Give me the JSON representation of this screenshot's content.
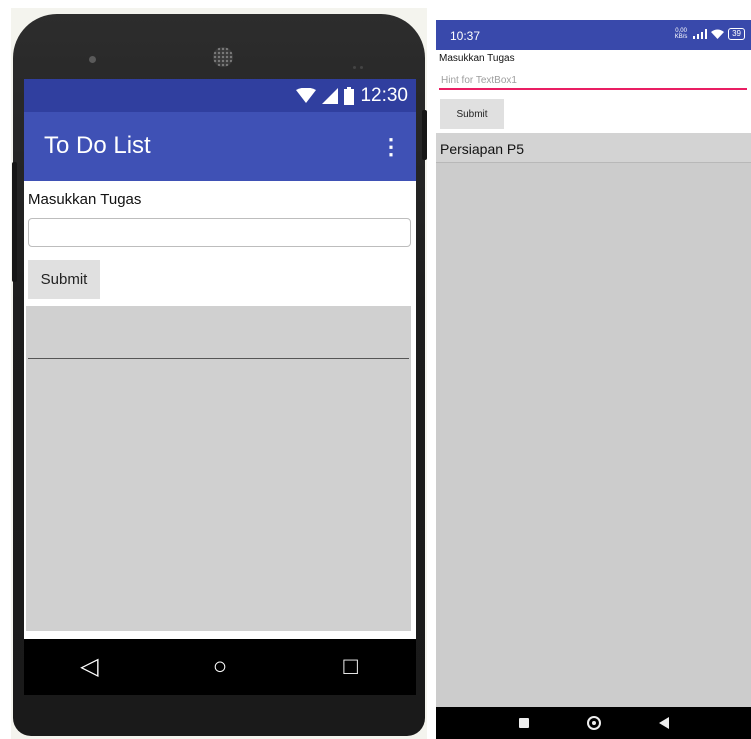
{
  "emulator": {
    "status": {
      "time": "12:30",
      "wifi_icon": "wifi-icon",
      "signal_icon": "signal-icon",
      "battery_icon": "battery-icon"
    },
    "app_bar": {
      "title": "To Do List",
      "overflow_icon": "⋮"
    },
    "form": {
      "label": "Masukkan Tugas",
      "input_value": "",
      "submit_label": "Submit"
    },
    "list": {
      "items": [
        ""
      ]
    },
    "nav": {
      "back_icon": "◁",
      "home_icon": "○",
      "recents_icon": "□"
    },
    "colors": {
      "status_bar": "#303f9f",
      "app_bar": "#3f51b5",
      "list_bg": "#d0d0d0"
    }
  },
  "device": {
    "status": {
      "time": "10:37",
      "net_speed": "0,00 KB/s",
      "battery": "39"
    },
    "form": {
      "label": "Masukkan Tugas",
      "placeholder": "Hint for TextBox1",
      "submit_label": "Submit"
    },
    "list": {
      "items": [
        "Persiapan P5"
      ]
    },
    "colors": {
      "status_bar": "#3949ab",
      "input_underline": "#e91e63",
      "list_bg": "#cccccc"
    }
  }
}
